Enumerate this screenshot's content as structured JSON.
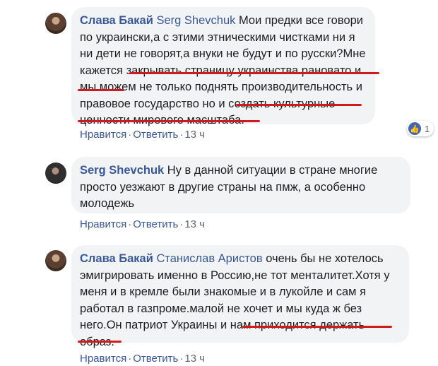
{
  "comments": [
    {
      "author": "Слава Бакай",
      "mention": "Serg Shevchuk",
      "text_1": " Мои предки все говори по украински,а с этими этническими чистками ни я ни дети не говорят,а внуки не будут и по русски?Мне кажется ",
      "hl_1": "закрывать страницу украинства рановато",
      "text_2": " и мы ",
      "hl_2": "можем",
      "text_3": " не только поднять производительность и правовое государство но и ",
      "hl_3": "создать культурные ценности мирового масштаба.",
      "like_label": "Нравится",
      "reply_label": "Ответить",
      "time": "13 ч",
      "reaction_count": "1",
      "reaction_icon": "like-icon"
    },
    {
      "author": "Serg Shevchuk",
      "text_1": " Ну в данной ситуации в стране многие просто уезжают в другие страны на пмж, а особенно молодежь",
      "like_label": "Нравится",
      "reply_label": "Ответить",
      "time": "13 ч"
    },
    {
      "author": "Слава Бакай",
      "mention": "Станислав Аристов",
      "text_1": " очень бы не хотелось эмигрировать именно в Россию,не тот менталитет.Хотя у меня и в кремле были знакомые и в лукойле и сам я работал в газпроме.малой не хочет и мы куда ж без него.Он патриот Украины и ",
      "hl_1": "нам приходится держать образ.",
      "like_label": "Нравится",
      "reply_label": "Ответить",
      "time": "13 ч"
    }
  ],
  "colors": {
    "link": "#385898",
    "bubble": "#f2f3f5",
    "underline": "#d11a1a",
    "meta": "#606770"
  }
}
